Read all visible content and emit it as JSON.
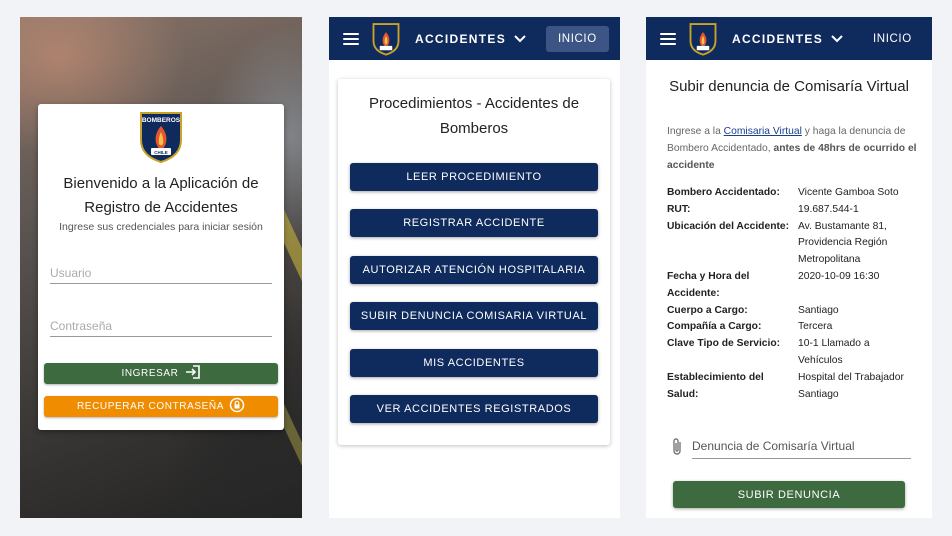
{
  "login": {
    "welcome_title": "Bienvenido a la Aplicación de Registro de Accidentes",
    "subtitle": "Ingrese sus credenciales para iniciar sesión",
    "username_placeholder": "Usuario",
    "password_placeholder": "Contraseña",
    "login_button": "INGRESAR",
    "recover_button": "RECUPERAR CONTRASEÑA",
    "login_icon": "login-icon",
    "recover_icon": "lock-reset-icon"
  },
  "logo": {
    "top_text": "BOMBEROS",
    "bottom_text": "CHILE"
  },
  "nav": {
    "accidentes": "ACCIDENTES",
    "inicio": "INICIO"
  },
  "procedures": {
    "title": "Procedimientos - Accidentes de Bomberos",
    "buttons": [
      "LEER PROCEDIMIENTO",
      "REGISTRAR ACCIDENTE",
      "AUTORIZAR ATENCIÓN HOSPITALARIA",
      "SUBIR DENUNCIA COMISARIA VIRTUAL",
      "MIS ACCIDENTES",
      "VER ACCIDENTES REGISTRADOS"
    ]
  },
  "upload": {
    "title": "Subir denuncia de Comisaría Virtual",
    "intro_prefix": "Ingrese a la ",
    "intro_link": "Comisaria Virtual",
    "intro_middle": " y haga la denuncia de Bombero Accidentado, ",
    "intro_bold": "antes de 48hrs de ocurrido el accidente",
    "details": [
      {
        "label": "Bombero Accidentado:",
        "value": "Vicente Gamboa Soto"
      },
      {
        "label": "RUT:",
        "value": "19.687.544-1"
      },
      {
        "label": "Ubicación del Accidente:",
        "value": "Av. Bustamante 81, Providencia Región Metropolitana"
      },
      {
        "label": "Fecha y Hora del Accidente:",
        "value": "2020-10-09 16:30"
      },
      {
        "label": "Cuerpo a Cargo:",
        "value": "Santiago"
      },
      {
        "label": "Compañía a Cargo:",
        "value": "Tercera"
      },
      {
        "label": "Clave Tipo de Servicio:",
        "value": "10-1 Llamado a Vehículos"
      },
      {
        "label": "Establecimiento del Salud:",
        "value": "Hospital del Trabajador Santiago"
      }
    ],
    "file_placeholder": "Denuncia de Comisaría Virtual",
    "submit_button": "SUBIR DENUNCIA"
  },
  "colors": {
    "navy": "#0f2a5c",
    "green": "#3d6b3f",
    "orange": "#f08c00"
  }
}
